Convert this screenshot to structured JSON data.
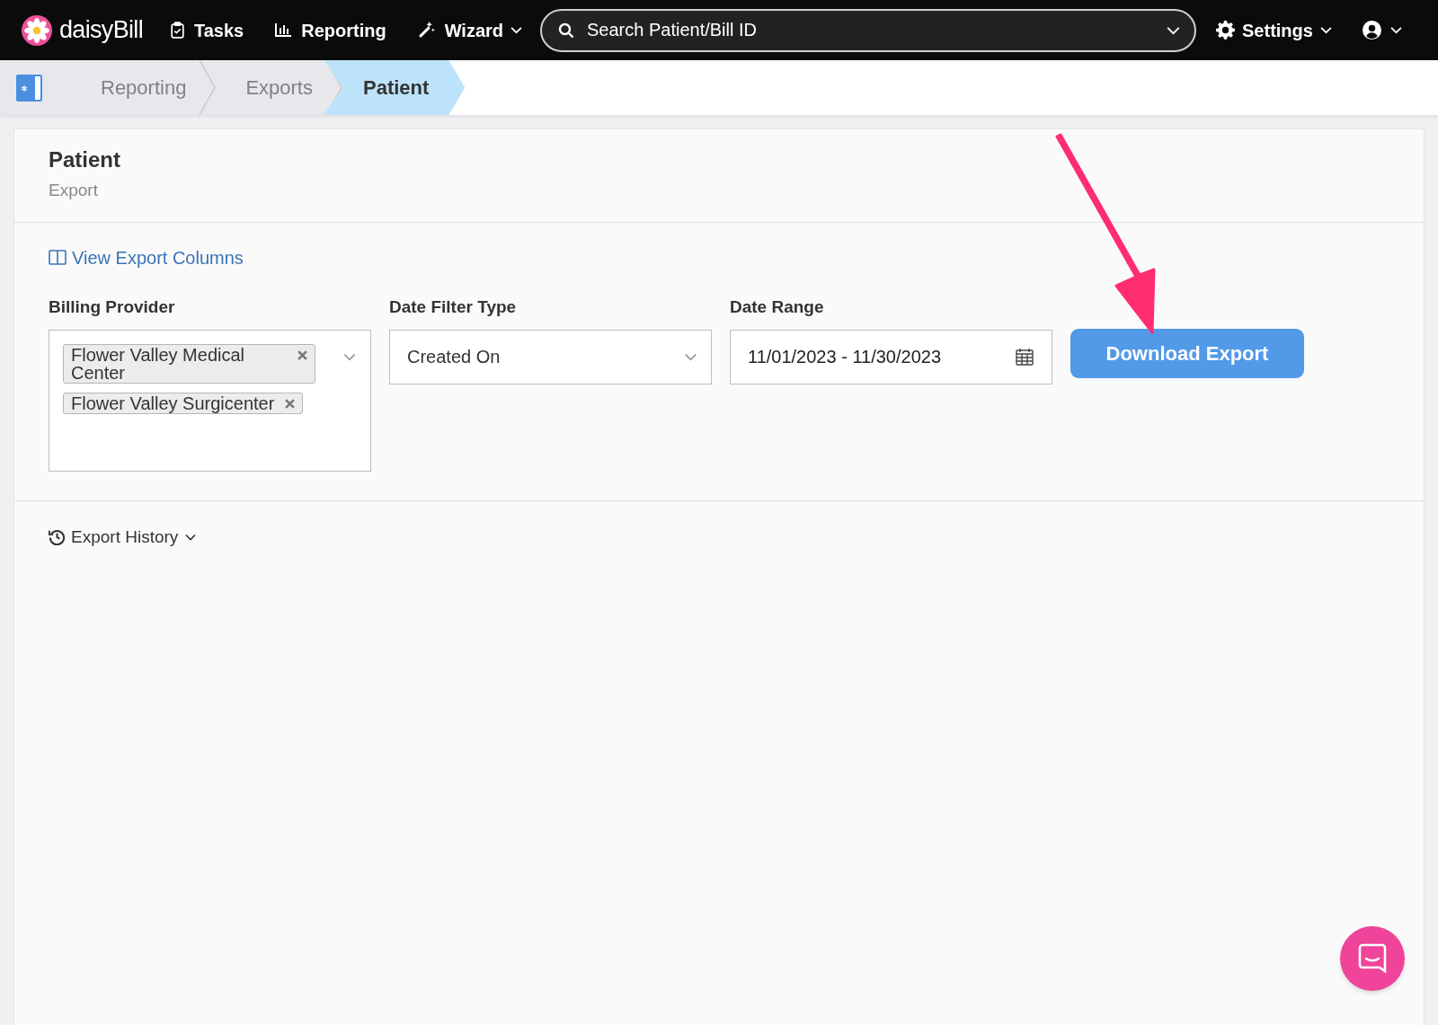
{
  "nav": {
    "logo": "daisy**Bill**",
    "items": [
      {
        "label": "Tasks",
        "kind": "tasks",
        "dropdown": false
      },
      {
        "label": "Reporting",
        "kind": "reporting",
        "dropdown": false
      },
      {
        "label": "Wizard",
        "kind": "wizard",
        "dropdown": true
      }
    ],
    "search": {
      "placeholder": "Search Patient/Bill ID"
    },
    "settings": "Settings"
  },
  "breadcrumbs": [
    {
      "label": "Reporting",
      "selected": false
    },
    {
      "label": "Exports",
      "selected": false
    },
    {
      "label": "Patient",
      "selected": true
    }
  ],
  "page": {
    "title": "Patient",
    "subtitle": "Export",
    "columns_link": "View Export Columns",
    "billing_provider": {
      "label": "Billing Provider",
      "tags": [
        "Flower Valley Medical Center",
        "Flower Valley Surgicenter"
      ]
    },
    "date_filter_type": {
      "label": "Date Filter Type",
      "value": "Created On"
    },
    "date_range": {
      "label": "Date Range",
      "value": "11/01/2023 - 11/30/2023"
    },
    "download_button": "Download Export",
    "history": "Export History"
  }
}
